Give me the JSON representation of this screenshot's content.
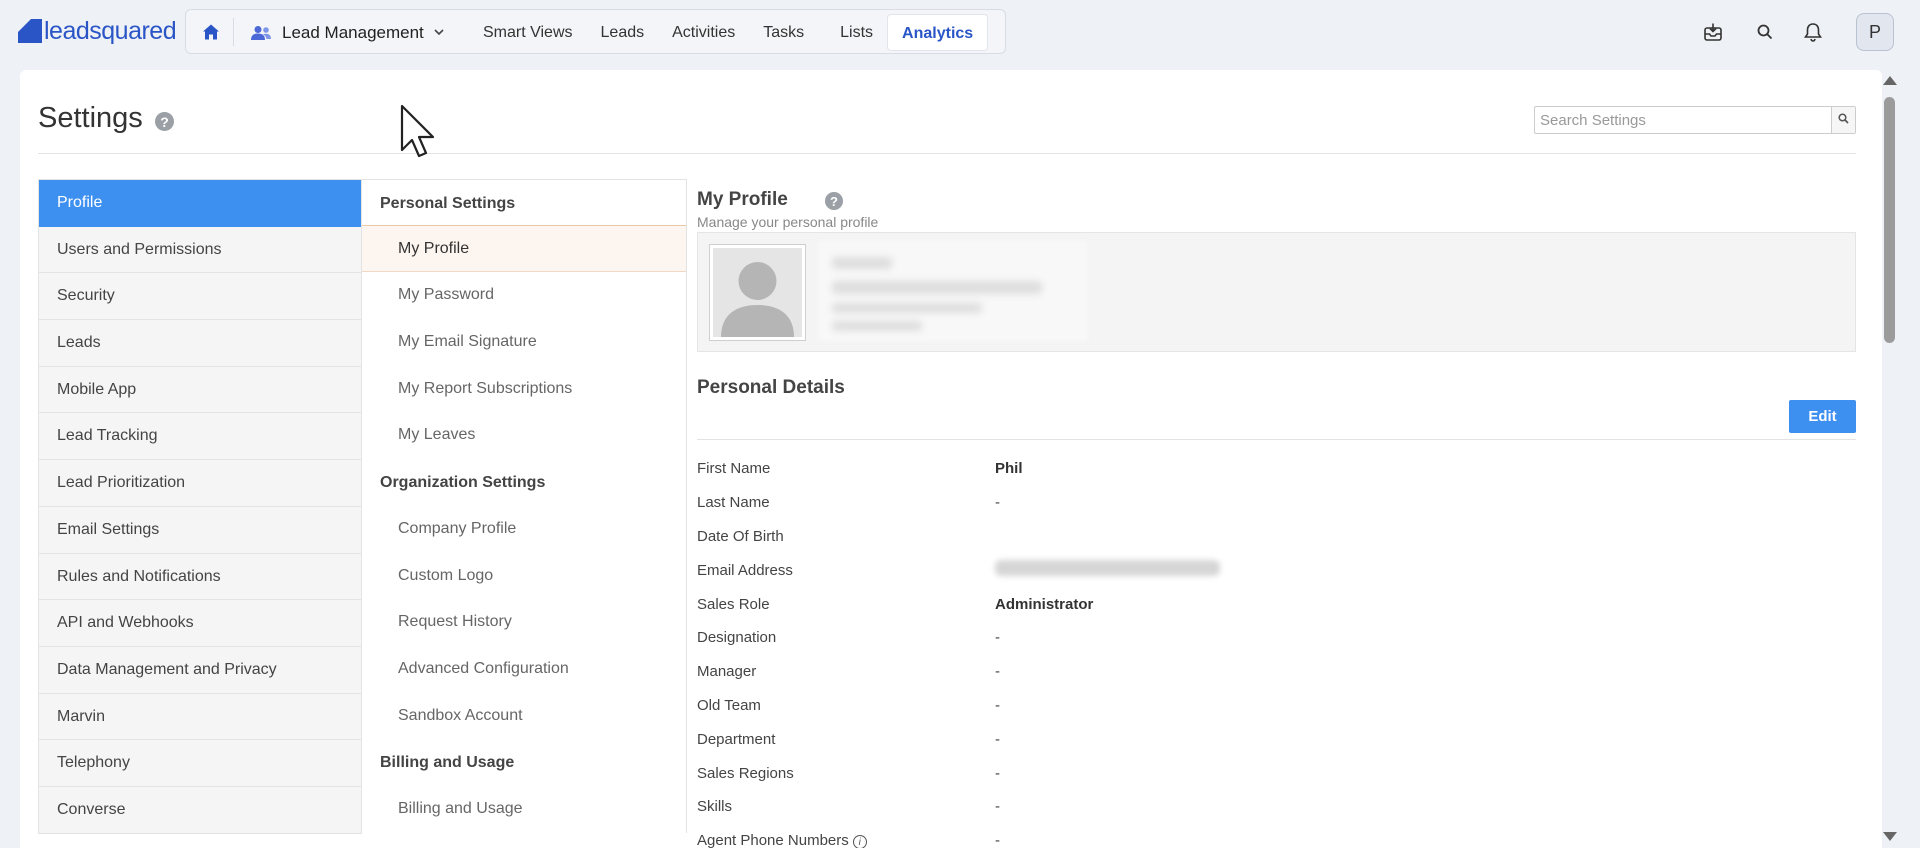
{
  "brand": {
    "name": "leadsquared",
    "color": "#2a55c7"
  },
  "nav": {
    "app_label": "Lead Management",
    "links": [
      {
        "label": "Smart Views",
        "active": false
      },
      {
        "label": "Leads",
        "active": false
      },
      {
        "label": "Activities",
        "active": false
      },
      {
        "label": "Tasks",
        "active": false
      },
      {
        "label": "Lists",
        "active": false
      },
      {
        "label": "Analytics",
        "active": true
      }
    ],
    "icons": [
      "home-icon",
      "people-icon",
      "chevron-down-icon",
      "inbox-download-icon",
      "search-icon",
      "bell-icon"
    ],
    "avatar_initial": "P"
  },
  "settings": {
    "title": "Settings",
    "search_placeholder": "Search Settings"
  },
  "left_menu": [
    {
      "label": "Profile",
      "active": true
    },
    {
      "label": "Users and Permissions"
    },
    {
      "label": "Security"
    },
    {
      "label": "Leads"
    },
    {
      "label": "Mobile App"
    },
    {
      "label": "Lead Tracking"
    },
    {
      "label": "Lead Prioritization"
    },
    {
      "label": "Email Settings"
    },
    {
      "label": "Rules and Notifications"
    },
    {
      "label": "API and Webhooks"
    },
    {
      "label": "Data Management and Privacy"
    },
    {
      "label": "Marvin"
    },
    {
      "label": "Telephony"
    },
    {
      "label": "Converse"
    }
  ],
  "mid_menu": [
    {
      "type": "head",
      "label": "Personal Settings"
    },
    {
      "type": "item",
      "label": "My Profile",
      "active": true
    },
    {
      "type": "item",
      "label": "My Password"
    },
    {
      "type": "item",
      "label": "My Email Signature"
    },
    {
      "type": "item",
      "label": "My Report Subscriptions"
    },
    {
      "type": "item",
      "label": "My Leaves"
    },
    {
      "type": "head",
      "label": "Organization Settings"
    },
    {
      "type": "item",
      "label": "Company Profile"
    },
    {
      "type": "item",
      "label": "Custom Logo"
    },
    {
      "type": "item",
      "label": "Request History"
    },
    {
      "type": "item",
      "label": "Advanced Configuration"
    },
    {
      "type": "item",
      "label": "Sandbox Account"
    },
    {
      "type": "head",
      "label": "Billing and Usage"
    },
    {
      "type": "item",
      "label": "Billing and Usage"
    }
  ],
  "profile": {
    "title": "My Profile",
    "subtitle": "Manage your personal profile",
    "personal_details_title": "Personal Details",
    "edit_label": "Edit",
    "fields": [
      {
        "label": "First Name",
        "value": "Phil",
        "bold": true
      },
      {
        "label": "Last Name",
        "value": "-"
      },
      {
        "label": "Date Of Birth",
        "value": ""
      },
      {
        "label": "Email Address",
        "value": "",
        "blurred": true
      },
      {
        "label": "Sales Role",
        "value": "Administrator",
        "bold": true
      },
      {
        "label": "Designation",
        "value": "-"
      },
      {
        "label": "Manager",
        "value": "-"
      },
      {
        "label": "Old Team",
        "value": "-"
      },
      {
        "label": "Department",
        "value": "-"
      },
      {
        "label": "Sales Regions",
        "value": "-"
      },
      {
        "label": "Skills",
        "value": "-"
      },
      {
        "label": "Agent Phone Numbers",
        "value": "-",
        "info": true
      }
    ]
  },
  "colors": {
    "accent_blue": "#3d8ff0",
    "selected_row_bg": "#fdf5ef",
    "page_bg": "#eef1f5"
  }
}
